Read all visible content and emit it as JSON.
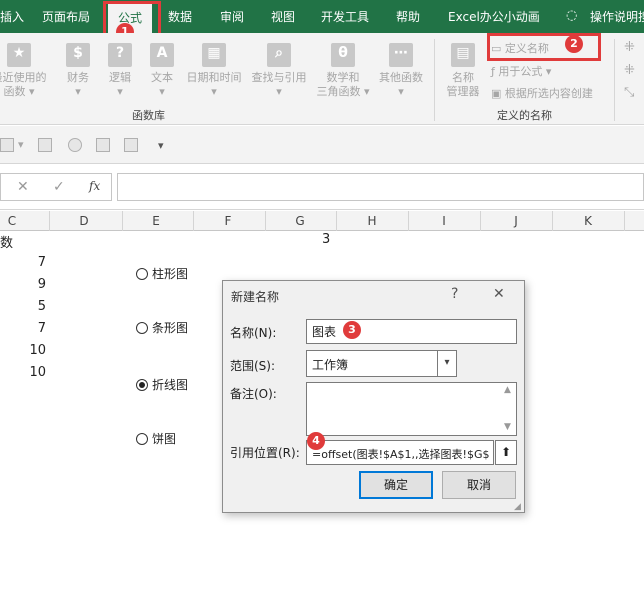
{
  "tabs": [
    "插入",
    "页面布局",
    "公式",
    "数据",
    "审阅",
    "视图",
    "开发工具",
    "帮助",
    "Excel办公小动画",
    "操作说明搜"
  ],
  "active_tab": "公式",
  "ribbon": {
    "buttons": [
      {
        "label": "最近使用的\n函数",
        "icon": "★"
      },
      {
        "label": "财务",
        "icon": "$"
      },
      {
        "label": "逻辑",
        "icon": "?"
      },
      {
        "label": "文本",
        "icon": "A"
      },
      {
        "label": "日期和时间",
        "icon": "▦"
      },
      {
        "label": "查找与引用",
        "icon": "⌕"
      },
      {
        "label": "数学和\n三角函数",
        "icon": "θ"
      },
      {
        "label": "其他函数",
        "icon": "⋯"
      },
      {
        "label": "名称\n管理器",
        "icon": "▤"
      }
    ],
    "group_function_library": "函数库",
    "group_defined_names": "定义的名称",
    "define_name": "定义名称",
    "use_in_formula": "用于公式",
    "create_from_selection": "根据所选内容创建"
  },
  "formula_bar": {
    "fx": "fx",
    "cancel": "✕",
    "confirm": "✓",
    "value": ""
  },
  "columns": [
    "C",
    "D",
    "E",
    "F",
    "G",
    "H",
    "I",
    "J",
    "K"
  ],
  "cells": {
    "c1": "数",
    "g1": "3",
    "d_values": [
      "7",
      "9",
      "5",
      "7",
      "10",
      "10"
    ]
  },
  "radio_options": [
    {
      "label": "柱形图",
      "checked": false
    },
    {
      "label": "条形图",
      "checked": false
    },
    {
      "label": "折线图",
      "checked": true
    },
    {
      "label": "饼图",
      "checked": false
    }
  ],
  "dialog": {
    "title": "新建名称",
    "help": "?",
    "close": "✕",
    "name_label": "名称(N):",
    "name_value": "图表",
    "scope_label": "范围(S):",
    "scope_value": "工作簿",
    "comment_label": "备注(O):",
    "comment_value": "",
    "ref_label": "引用位置(R):",
    "ref_value": "=offset(图表!$A$1,,选择图表!$G$",
    "ok": "确定",
    "cancel": "取消"
  },
  "badges": [
    "1",
    "2",
    "3",
    "4"
  ],
  "colors": {
    "ribbon_green": "#217346",
    "highlight_red": "#e03b3b",
    "focus_blue": "#0078d7"
  }
}
